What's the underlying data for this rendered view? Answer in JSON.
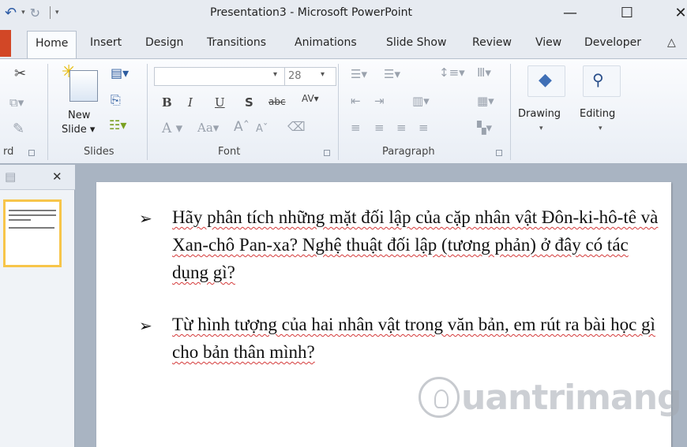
{
  "window": {
    "title": "Presentation3 - Microsoft PowerPoint",
    "minimize": "—",
    "maximize": "☐",
    "close": "✕"
  },
  "tabs": [
    "Home",
    "Insert",
    "Design",
    "Transitions",
    "Animations",
    "Slide Show",
    "Review",
    "View",
    "Developer"
  ],
  "ribbon": {
    "slides": {
      "new_slide_line1": "New",
      "new_slide_line2": "Slide ▾",
      "group_label": "Slides"
    },
    "font": {
      "font_name": "",
      "font_size": "28",
      "group_label": "Font"
    },
    "paragraph": {
      "group_label": "Paragraph"
    },
    "drawing": {
      "label": "Drawing"
    },
    "editing": {
      "label": "Editing"
    },
    "clipboard": {
      "group_label": "rd"
    }
  },
  "slide": {
    "bullets": [
      "Hãy phân tích những mặt đối lập của cặp nhân vật Đôn-ki-hô-tê và Xan-chô Pan-xa?  Nghệ thuật đối lập (tương phản) ở đây có tác dụng gì?",
      "Từ hình tượng của hai nhân vật trong văn bản, em rút ra bài học gì cho bản thân mình?"
    ]
  },
  "watermark": {
    "text": "uantrimang"
  },
  "colors": {
    "ribbon_bg": "#e9eef5",
    "file_tab": "#d24726",
    "thumb_border": "#f7c54a",
    "spell_underline": "#d43a3a"
  }
}
